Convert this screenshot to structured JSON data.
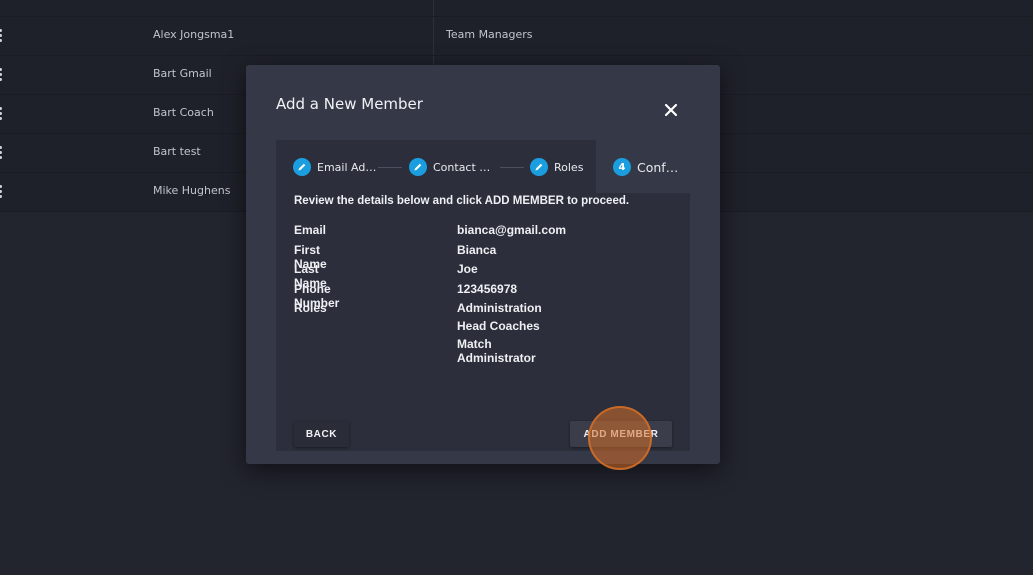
{
  "background_table": {
    "rows": [
      {
        "name": "Alex Jongsma1",
        "role": "Team Managers"
      },
      {
        "name": "Bart Gmail",
        "role": ""
      },
      {
        "name": "Bart Coach",
        "role": ""
      },
      {
        "name": "Bart test",
        "role": ""
      },
      {
        "name": "Mike Hughens",
        "role": ""
      }
    ]
  },
  "modal": {
    "title": "Add a New Member",
    "close_icon": "close-icon",
    "steps": [
      {
        "number": "",
        "icon": "pencil-icon",
        "label": "Email Ad…"
      },
      {
        "number": "",
        "icon": "pencil-icon",
        "label": "Contact …"
      },
      {
        "number": "",
        "icon": "pencil-icon",
        "label": "Roles"
      },
      {
        "number": "4",
        "icon": "",
        "label": "Conf…"
      }
    ],
    "instruction": "Review the details below and click ADD MEMBER to proceed.",
    "details": {
      "email_label": "Email",
      "email_value": "bianca@gmail.com",
      "first_name_label": "First Name",
      "first_name_value": "Bianca",
      "last_name_label": "Last Name",
      "last_name_value": "Joe",
      "phone_label": "Phone Number",
      "phone_value": "123456978",
      "roles_label": "Roles",
      "roles": [
        "Administration",
        "Head Coaches",
        "Match Administrator"
      ]
    },
    "back_label": "BACK",
    "add_label": "ADD MEMBER"
  },
  "colors": {
    "accent": "#1a9ee0",
    "modal_bg": "#353846",
    "panel_bg": "#2c2f3b",
    "click_highlight": "#d66e28"
  }
}
